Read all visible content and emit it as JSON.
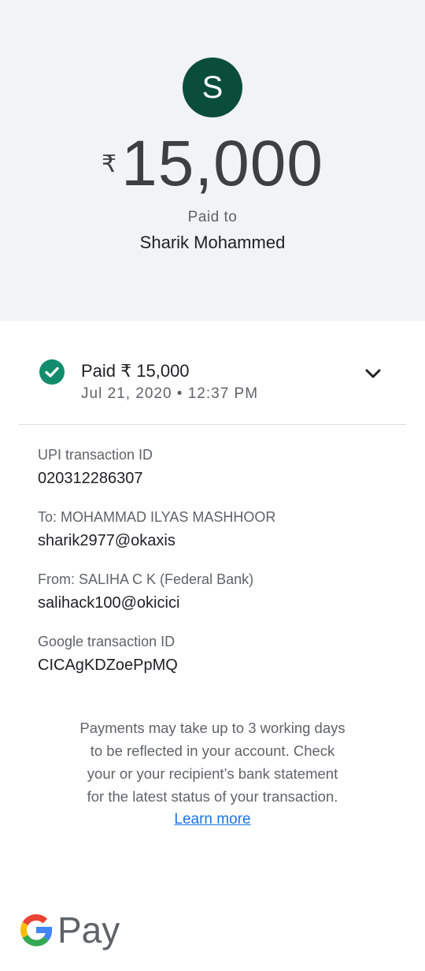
{
  "header": {
    "avatar_letter": "S",
    "currency_symbol": "₹",
    "amount": "15,000",
    "paid_to_label": "Paid to",
    "payee_name": "Sharik Mohammed"
  },
  "status": {
    "title": "Paid ₹ 15,000",
    "datetime": "Jul 21, 2020 • 12:37 PM",
    "icon": "check-circle-icon",
    "expand_icon": "chevron-down-icon"
  },
  "details": [
    {
      "label": "UPI transaction ID",
      "value": "020312286307"
    },
    {
      "label": "To: MOHAMMAD ILYAS MASHHOOR",
      "value": "sharik2977@okaxis"
    },
    {
      "label": "From: SALIHA C K (Federal Bank)",
      "value": "salihack100@okicici"
    },
    {
      "label": "Google transaction ID",
      "value": "CICAgKDZoePpMQ"
    }
  ],
  "notice": {
    "lines": [
      "Payments may take up to 3 working days",
      "to be reflected in your account. Check",
      "your or your recipient’s bank statement",
      "for the latest status of your transaction."
    ],
    "link": "Learn more"
  },
  "footer": {
    "brand_text": "Pay",
    "logo_icon": "google-g-icon"
  },
  "colors": {
    "avatar_bg": "#0b4d3b",
    "success": "#128c6a",
    "link": "#1a73e8",
    "header_bg": "#f1f3f4"
  }
}
